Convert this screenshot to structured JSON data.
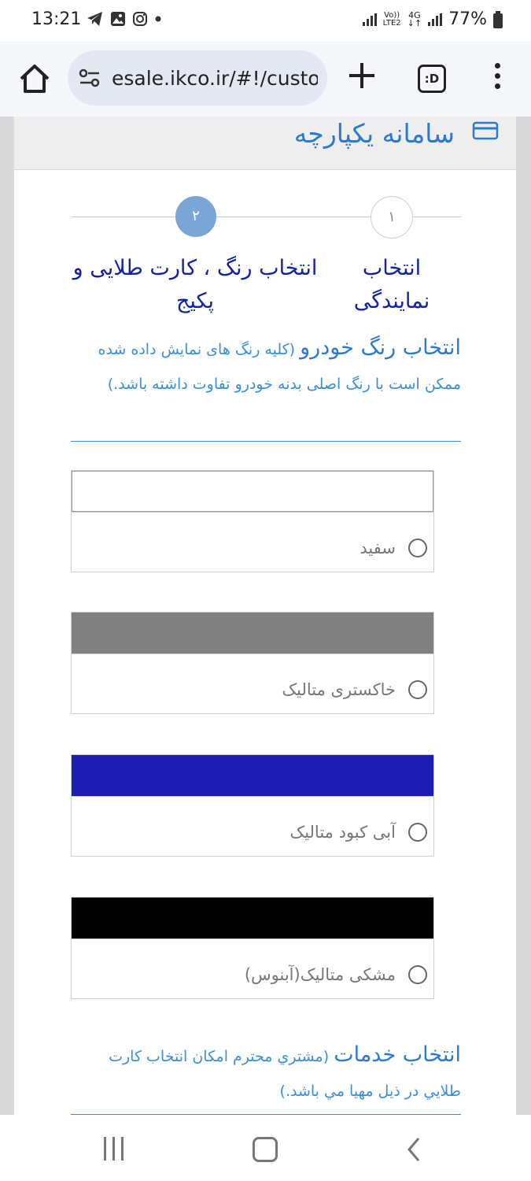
{
  "status_bar": {
    "time": "13:21",
    "network_top": "Vo))",
    "network_bottom": "LTE2",
    "data_type": "4G",
    "battery": "77%"
  },
  "browser": {
    "url": "esale.ikco.ir/#!/custo",
    "tab_icon_label": ":D"
  },
  "header": {
    "site_title": "سامانه یکپارچه"
  },
  "stepper": {
    "steps": [
      {
        "number": "۱",
        "label": "انتخاب نمایندگی"
      },
      {
        "number": "۲",
        "label": "انتخاب رنگ ، کارت طلایی و پکیج"
      }
    ]
  },
  "color_section": {
    "title": "انتخاب رنگ خودرو",
    "note": "(کلیه رنگ های نمایش داده شده ممکن است با رنگ اصلی بدنه خودرو تفاوت داشته باشد.)"
  },
  "colors": [
    {
      "name": "سفید",
      "swatch": "#ffffff"
    },
    {
      "name": "خاکستری متالیک",
      "swatch": "#808080"
    },
    {
      "name": "آبی کبود متالیک",
      "swatch": "#1c1cb4"
    },
    {
      "name": "مشکی متالیک(آبنوس)",
      "swatch": "#000000"
    }
  ],
  "services_section": {
    "title": "انتخاب خدمات",
    "note": "(مشتري محترم امکان انتخاب کارت طلايي در ذيل مهيا مي باشد.)"
  }
}
